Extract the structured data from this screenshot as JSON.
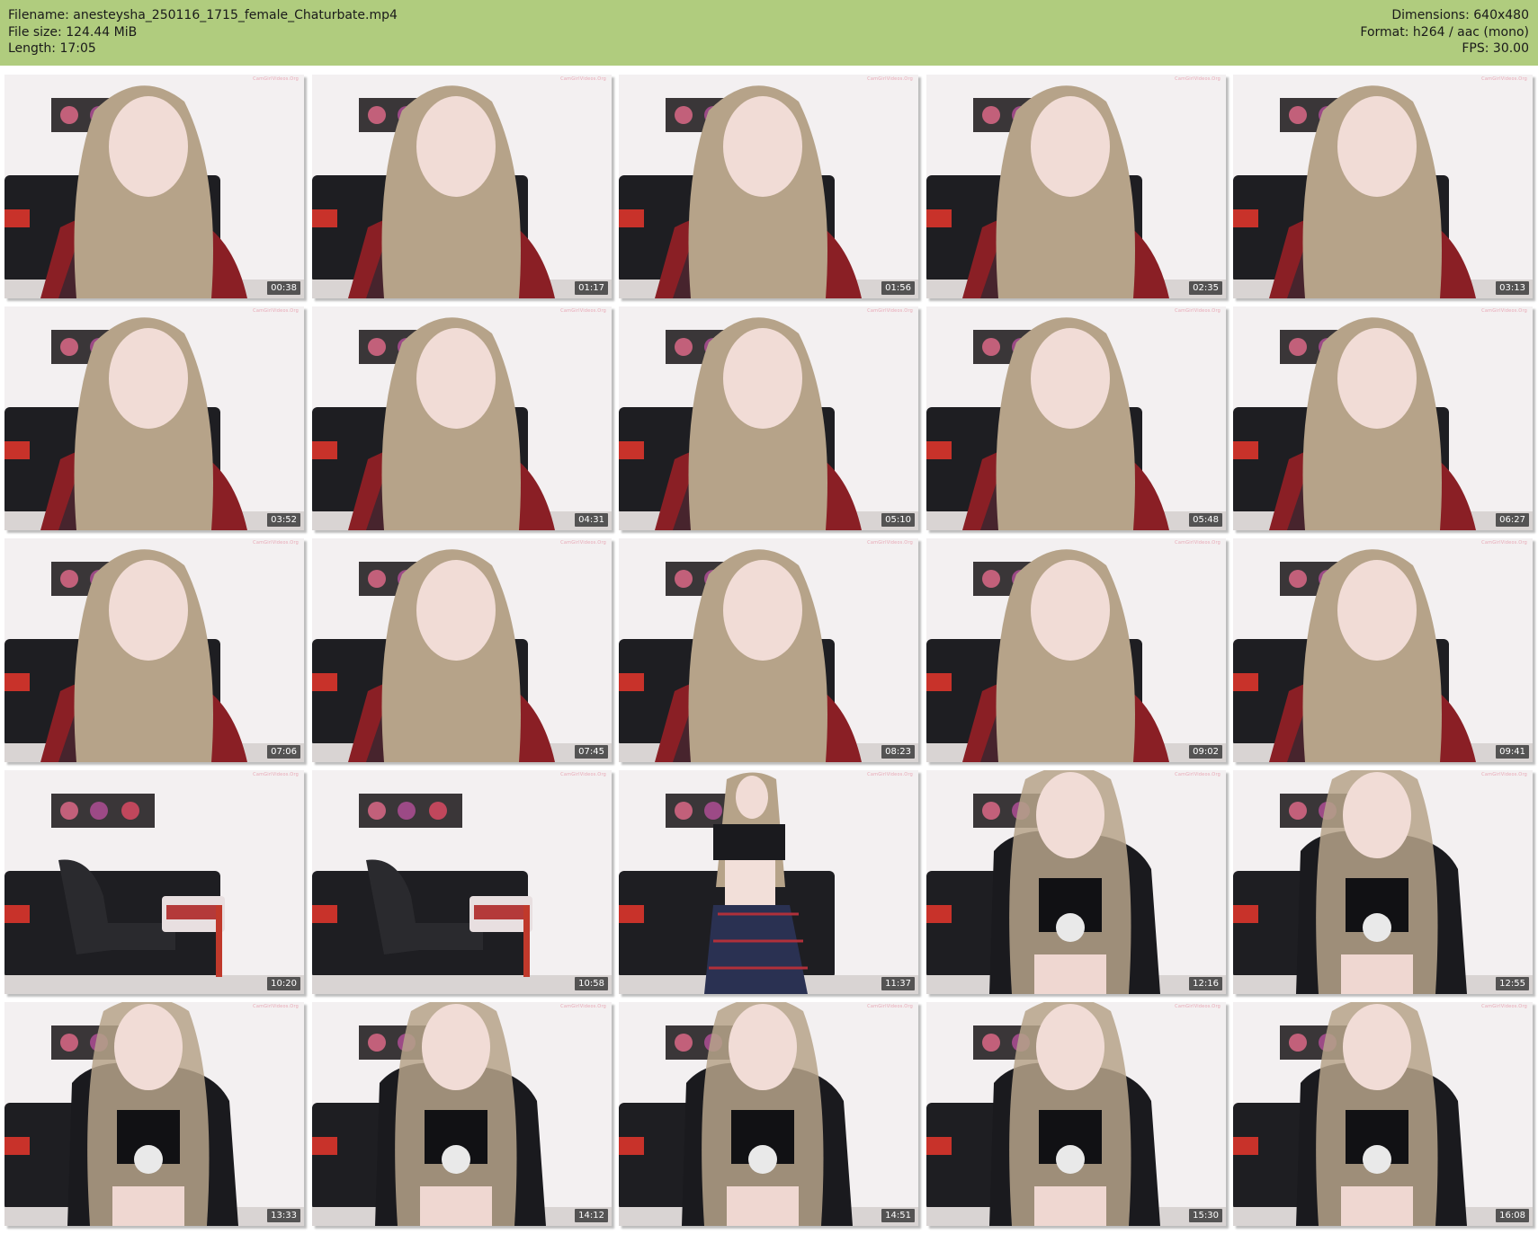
{
  "header": {
    "filename": "Filename: anesteysha_250116_1715_female_Chaturbate.mp4",
    "filesize": "File size: 124.44 MiB",
    "length": "Length: 17:05",
    "dimensions": "Dimensions: 640x480",
    "format": "Format: h264 / aac (mono)",
    "fps": "FPS: 30.00"
  },
  "watermark": "CamGirlVideos.Org",
  "colors": {
    "header_bg": "#b0cc7e",
    "timestamp_bg": "#373737"
  },
  "thumbnails": [
    {
      "time": "00:38",
      "scene": "plaid"
    },
    {
      "time": "01:17",
      "scene": "plaid"
    },
    {
      "time": "01:56",
      "scene": "plaid"
    },
    {
      "time": "02:35",
      "scene": "plaid"
    },
    {
      "time": "03:13",
      "scene": "plaid"
    },
    {
      "time": "03:52",
      "scene": "plaid"
    },
    {
      "time": "04:31",
      "scene": "plaid"
    },
    {
      "time": "05:10",
      "scene": "plaid"
    },
    {
      "time": "05:48",
      "scene": "plaid"
    },
    {
      "time": "06:27",
      "scene": "plaid"
    },
    {
      "time": "07:06",
      "scene": "plaid"
    },
    {
      "time": "07:45",
      "scene": "plaid"
    },
    {
      "time": "08:23",
      "scene": "plaid"
    },
    {
      "time": "09:02",
      "scene": "plaid"
    },
    {
      "time": "09:41",
      "scene": "plaid"
    },
    {
      "time": "10:20",
      "scene": "empty"
    },
    {
      "time": "10:58",
      "scene": "empty"
    },
    {
      "time": "11:37",
      "scene": "standing"
    },
    {
      "time": "12:16",
      "scene": "crop"
    },
    {
      "time": "12:55",
      "scene": "crop"
    },
    {
      "time": "13:33",
      "scene": "crop"
    },
    {
      "time": "14:12",
      "scene": "crop"
    },
    {
      "time": "14:51",
      "scene": "crop"
    },
    {
      "time": "15:30",
      "scene": "crop"
    },
    {
      "time": "16:08",
      "scene": "crop"
    }
  ]
}
